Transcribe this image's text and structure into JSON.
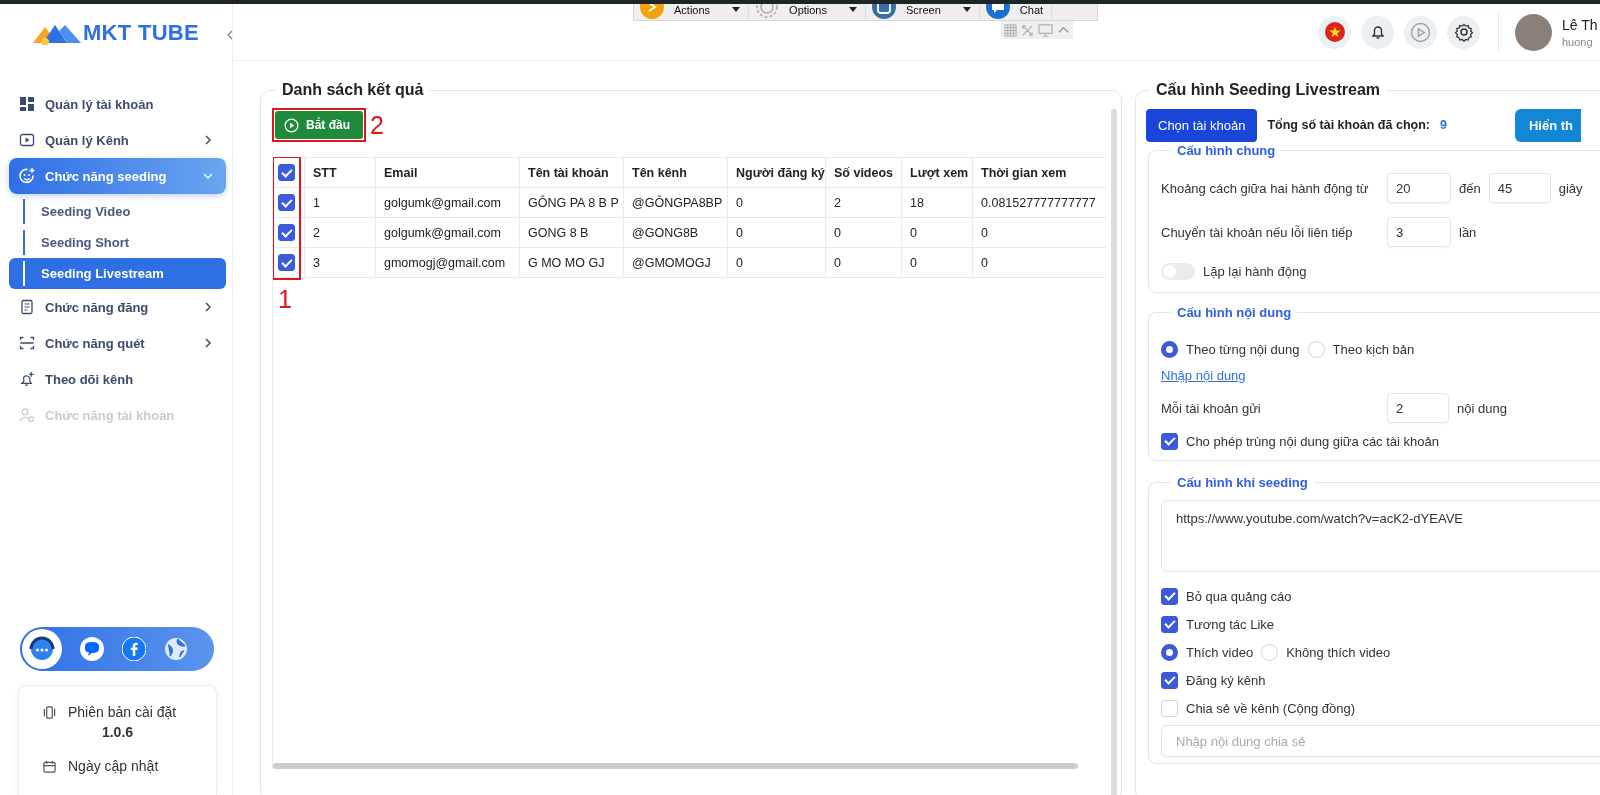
{
  "remote_toolbar": {
    "items": [
      {
        "label": "Actions"
      },
      {
        "label": "Options"
      },
      {
        "label": "Screen"
      },
      {
        "label": "Chat"
      }
    ]
  },
  "sidebar": {
    "logo": "MKT TUBE",
    "items": [
      {
        "kind": "link",
        "label": "Quản lý tài khoản",
        "selected": false,
        "disabled": false
      },
      {
        "kind": "group",
        "label": "Quản lý Kênh",
        "selected": false,
        "disabled": false,
        "expanded": false
      },
      {
        "kind": "group",
        "label": "Chức năng seeding",
        "selected": true,
        "disabled": false,
        "expanded": true,
        "children": [
          {
            "label": "Seeding Video",
            "selected": false
          },
          {
            "label": "Seeding Short",
            "selected": false
          },
          {
            "label": "Seeding Livestream",
            "selected": true
          }
        ]
      },
      {
        "kind": "group",
        "label": "Chức năng đăng",
        "selected": false,
        "disabled": false,
        "expanded": false
      },
      {
        "kind": "group",
        "label": "Chức năng quét",
        "selected": false,
        "disabled": false,
        "expanded": false
      },
      {
        "kind": "link",
        "label": "Theo dõi kênh",
        "selected": false,
        "disabled": false
      },
      {
        "kind": "link",
        "label": "Chức năng tài khoản",
        "selected": false,
        "disabled": true
      }
    ],
    "version_card": {
      "version_label": "Phiên bản cài đặt",
      "version": "1.0.6",
      "updated_label": "Ngày cập nhật"
    }
  },
  "header": {
    "user_name": "Lê Th",
    "user_sub": "huong"
  },
  "results": {
    "title": "Danh sách kết quả",
    "start_button": "Bắt đầu",
    "columns": [
      "STT",
      "Email",
      "Tên tài khoản",
      "Tên kênh",
      "Người đăng ký",
      "Số videos",
      "Lượt xem",
      "Thời gian xem"
    ],
    "select_all": {
      "checked": true
    },
    "rows": [
      {
        "checked": true,
        "cells": [
          "1",
          "golgumk@gmail.com",
          "GÔNG PA 8 B P",
          "@GÔNGPA8BP",
          "0",
          "2",
          "18",
          "0.081527777777777"
        ]
      },
      {
        "checked": true,
        "cells": [
          "2",
          "golgumk@gmail.com",
          "GONG 8 B",
          "@GONG8B",
          "0",
          "0",
          "0",
          "0"
        ]
      },
      {
        "checked": true,
        "cells": [
          "3",
          "gmomogj@gmail.com",
          "G MO MO GJ",
          "@GMOMOGJ",
          "0",
          "0",
          "0",
          "0"
        ]
      }
    ],
    "annotations": [
      {
        "label": "1"
      },
      {
        "label": "2"
      }
    ]
  },
  "config": {
    "title": "Cấu hình Seeding Livestream",
    "choose_button": "Chọn tài khoản",
    "total_label": "Tổng số tài khoản đã chọn:",
    "total_value": "9",
    "show_button": "Hiển th",
    "general": {
      "title": "Cấu hình chung",
      "interval": {
        "label": "Khoảng cách giữa hai hành động từ",
        "from": "20",
        "to_label": "đến",
        "to": "45",
        "unit": "giây"
      },
      "switch_account": {
        "label": "Chuyển tài khoản nếu lỗi liên tiếp",
        "value": "3",
        "unit": "lần"
      },
      "repeat": {
        "label": "Lặp lại hành động",
        "on": false
      }
    },
    "content": {
      "title": "Cấu hình nội dung",
      "modes": [
        {
          "label": "Theo từng nội dung",
          "selected": true
        },
        {
          "label": "Theo kịch bản",
          "selected": false
        }
      ],
      "link": "Nhập nội dung",
      "per_account": {
        "label": "Mỗi tài khoản gửi",
        "value": "2",
        "unit": "nội dung"
      },
      "allow_duplicate": {
        "label": "Cho phép trùng nội dung giữa các tài khoản",
        "checked": true
      }
    },
    "seeding": {
      "title": "Cấu hình khi seeding",
      "urls": "https://www.youtube.com/watch?v=acK2-dYEAVE",
      "options": [
        {
          "kind": "checkbox",
          "label": "Bỏ qua quảng cáo",
          "checked": true
        },
        {
          "kind": "checkbox",
          "label": "Tương tác Like",
          "checked": true
        },
        {
          "kind": "radios",
          "choices": [
            {
              "label": "Thích video",
              "selected": true
            },
            {
              "label": "Không thích video",
              "selected": false
            }
          ]
        },
        {
          "kind": "checkbox",
          "label": "Đăng ký kênh",
          "checked": true
        },
        {
          "kind": "checkbox",
          "label": "Chia sẻ về kênh (Cộng đồng)",
          "checked": false
        }
      ],
      "share_placeholder": "Nhập nội dung chia sẻ"
    }
  }
}
